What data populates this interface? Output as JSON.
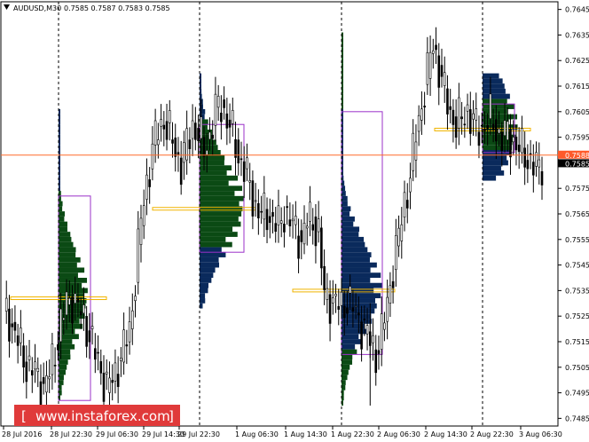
{
  "header": {
    "symbol": "AUDUSD,M30",
    "ohlc": "0.7585 0.7587 0.7583 0.7585"
  },
  "watermark": "www.instaforex.com",
  "colors": {
    "candle": "#000000",
    "profile_green": "#0b4a14",
    "profile_blue": "#0a2a5c",
    "value_area_box": "#9b30c8",
    "poc_line": "#f0b400",
    "current_price_line": "#ff6a2a",
    "price_tag_red": "#ff5a2a",
    "price_tag_black": "#000000",
    "watermark_bg": "#e03a3a"
  },
  "chart_data": {
    "type": "candlestick",
    "title": "AUDUSD,M30",
    "ylim": [
      0.7482,
      0.7648
    ],
    "y_ticks": [
      "0.7645",
      "0.7635",
      "0.7625",
      "0.7615",
      "0.7605",
      "0.7595",
      "0.7585",
      "0.7575",
      "0.7565",
      "0.7555",
      "0.7545",
      "0.7535",
      "0.7525",
      "0.7515",
      "0.7505",
      "0.7495",
      "0.7485"
    ],
    "x_ticks": [
      "28 Jul 2016",
      "28 Jul 22:30",
      "29 Jul 06:30",
      "29 Jul 14:30",
      "29 Jul 22:30",
      "1 Aug 06:30",
      "1 Aug 14:30",
      "1 Aug 22:30",
      "2 Aug 06:30",
      "2 Aug 14:30",
      "2 Aug 22:30",
      "3 Aug 06:30"
    ],
    "grid": false,
    "session_separators": [
      "28 Jul 22:30",
      "29 Jul 22:30",
      "1 Aug 22:30",
      "2 Aug 22:30"
    ],
    "price_labels": {
      "red": "0.7588",
      "black": "0.7585"
    },
    "current_price": 0.7588,
    "last_price": 0.7585,
    "close_path": [
      [
        0,
        0.7528
      ],
      [
        2,
        0.7524
      ],
      [
        4,
        0.7518
      ],
      [
        6,
        0.7512
      ],
      [
        8,
        0.7506
      ],
      [
        10,
        0.7504
      ],
      [
        12,
        0.7501
      ],
      [
        14,
        0.7497
      ],
      [
        16,
        0.7502
      ],
      [
        18,
        0.7512
      ],
      [
        20,
        0.7522
      ],
      [
        22,
        0.753
      ],
      [
        24,
        0.7532
      ],
      [
        26,
        0.7528
      ],
      [
        28,
        0.7524
      ],
      [
        30,
        0.7518
      ],
      [
        32,
        0.751
      ],
      [
        34,
        0.7504
      ],
      [
        36,
        0.7497
      ],
      [
        38,
        0.75
      ],
      [
        40,
        0.7506
      ],
      [
        42,
        0.7512
      ],
      [
        44,
        0.752
      ],
      [
        46,
        0.754
      ],
      [
        48,
        0.7562
      ],
      [
        50,
        0.7578
      ],
      [
        52,
        0.759
      ],
      [
        54,
        0.7598
      ],
      [
        56,
        0.7602
      ],
      [
        58,
        0.7596
      ],
      [
        60,
        0.759
      ],
      [
        62,
        0.7584
      ],
      [
        64,
        0.7592
      ],
      [
        66,
        0.76
      ],
      [
        68,
        0.7596
      ],
      [
        70,
        0.759
      ],
      [
        72,
        0.7596
      ],
      [
        74,
        0.7605
      ],
      [
        76,
        0.7608
      ],
      [
        78,
        0.7602
      ],
      [
        80,
        0.7596
      ],
      [
        82,
        0.7588
      ],
      [
        84,
        0.7582
      ],
      [
        86,
        0.7576
      ],
      [
        88,
        0.7568
      ],
      [
        90,
        0.7564
      ],
      [
        92,
        0.7566
      ],
      [
        94,
        0.7562
      ],
      [
        96,
        0.756
      ],
      [
        98,
        0.7566
      ],
      [
        100,
        0.7562
      ],
      [
        102,
        0.7558
      ],
      [
        104,
        0.7555
      ],
      [
        106,
        0.7562
      ],
      [
        108,
        0.7562
      ],
      [
        110,
        0.7558
      ],
      [
        112,
        0.7532
      ],
      [
        114,
        0.7532
      ],
      [
        116,
        0.753
      ],
      [
        118,
        0.7528
      ],
      [
        120,
        0.7532
      ],
      [
        122,
        0.7528
      ],
      [
        124,
        0.7524
      ],
      [
        126,
        0.752
      ],
      [
        128,
        0.7515
      ],
      [
        130,
        0.751
      ],
      [
        132,
        0.7518
      ],
      [
        134,
        0.753
      ],
      [
        136,
        0.7545
      ],
      [
        138,
        0.7556
      ],
      [
        140,
        0.757
      ],
      [
        142,
        0.758
      ],
      [
        144,
        0.7596
      ],
      [
        146,
        0.7608
      ],
      [
        148,
        0.762
      ],
      [
        150,
        0.7632
      ],
      [
        152,
        0.7622
      ],
      [
        154,
        0.7612
      ],
      [
        156,
        0.7605
      ],
      [
        158,
        0.76
      ],
      [
        160,
        0.7602
      ],
      [
        162,
        0.7606
      ],
      [
        164,
        0.76
      ],
      [
        166,
        0.7598
      ],
      [
        168,
        0.76
      ],
      [
        170,
        0.7602
      ],
      [
        172,
        0.7598
      ],
      [
        174,
        0.7595
      ],
      [
        176,
        0.7596
      ],
      [
        178,
        0.7594
      ],
      [
        180,
        0.759
      ],
      [
        182,
        0.7588
      ],
      [
        184,
        0.7586
      ],
      [
        186,
        0.7582
      ],
      [
        188,
        0.7585
      ]
    ],
    "volume_profiles": [
      {
        "session": "28 Jul",
        "poc": 0.7532,
        "va_high": 0.7572,
        "va_low": 0.7492,
        "dominant": "green"
      },
      {
        "session": "29 Jul",
        "poc": 0.7567,
        "va_high": 0.76,
        "va_low": 0.755,
        "dominant": "green"
      },
      {
        "session": "1 Aug",
        "poc": 0.7535,
        "va_high": 0.7605,
        "va_low": 0.751,
        "dominant": "blue"
      },
      {
        "session": "2 Aug",
        "poc": 0.7598,
        "va_high": 0.7608,
        "va_low": 0.7589,
        "dominant": "green"
      }
    ]
  }
}
